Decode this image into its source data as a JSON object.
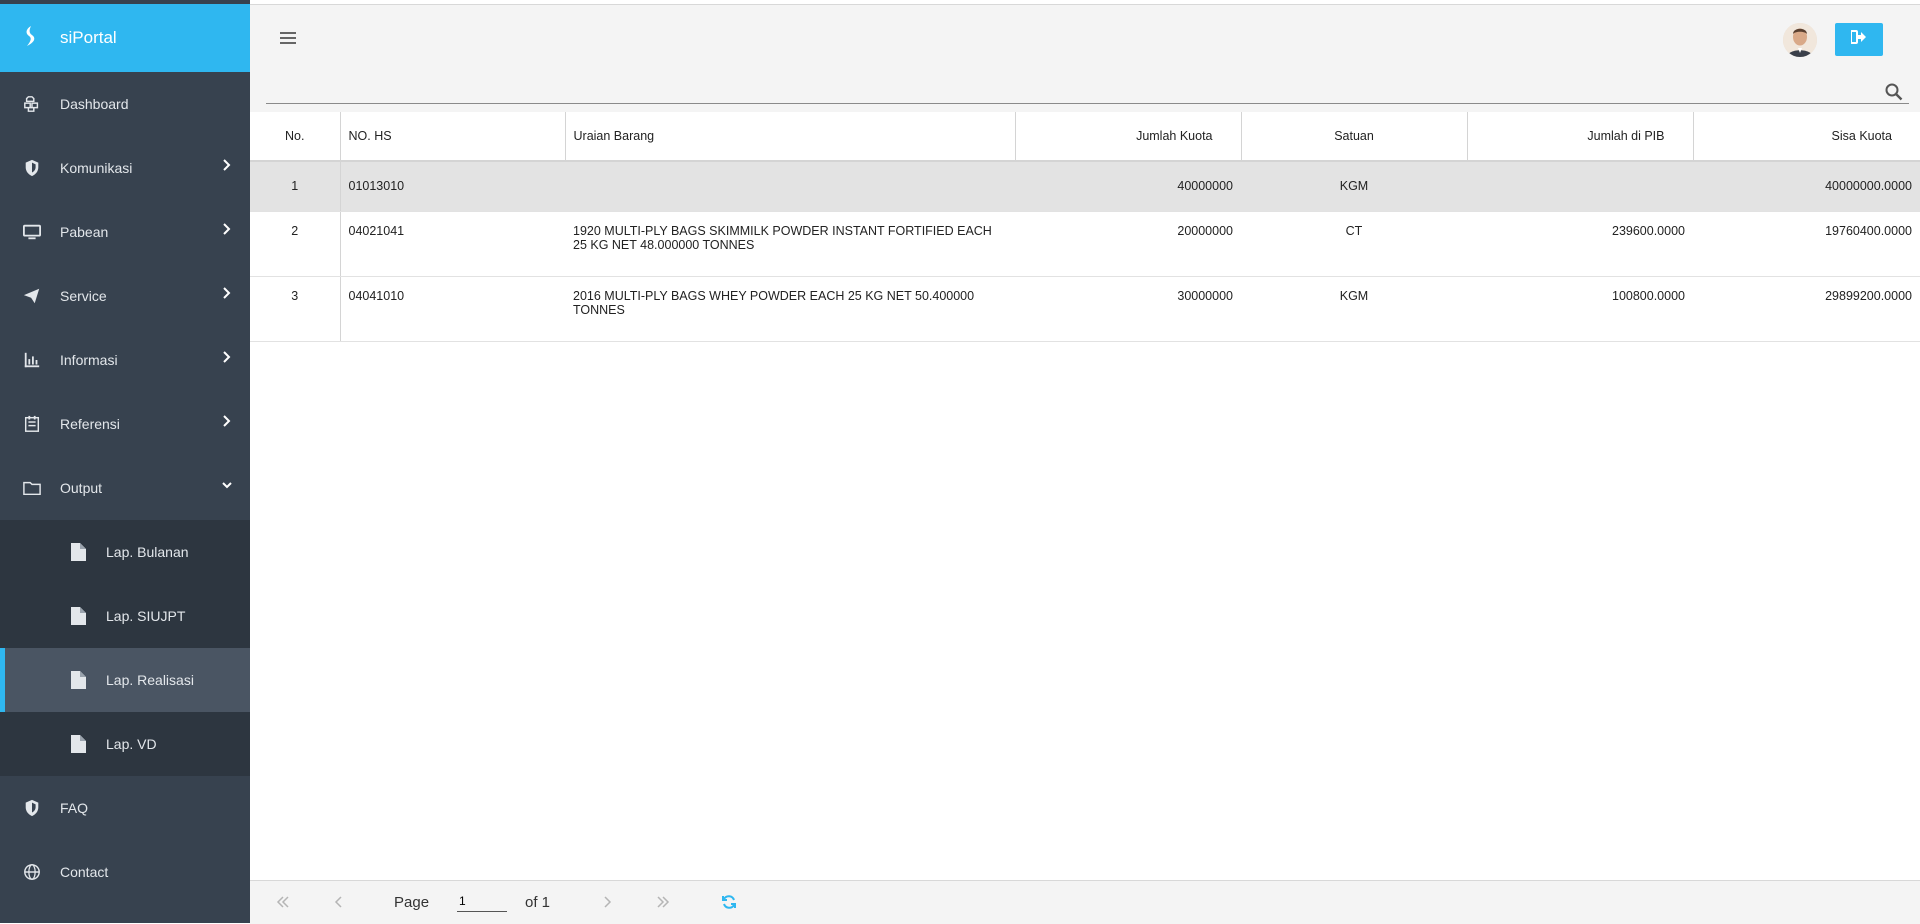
{
  "app": {
    "brand": "siPortal"
  },
  "sidebar": {
    "items": [
      {
        "label": "Dashboard",
        "icon": "cubes-icon",
        "has_children": false
      },
      {
        "label": "Komunikasi",
        "icon": "shield-icon",
        "has_children": true
      },
      {
        "label": "Pabean",
        "icon": "monitor-icon",
        "has_children": true
      },
      {
        "label": "Service",
        "icon": "paper-plane-icon",
        "has_children": true
      },
      {
        "label": "Informasi",
        "icon": "bar-chart-icon",
        "has_children": true
      },
      {
        "label": "Referensi",
        "icon": "calendar-icon",
        "has_children": true
      },
      {
        "label": "Output",
        "icon": "folder-icon",
        "has_children": true,
        "expanded": true
      }
    ],
    "output_children": [
      {
        "label": "Lap. Bulanan",
        "icon": "file-icon"
      },
      {
        "label": "Lap. SIUJPT",
        "icon": "file-icon"
      },
      {
        "label": "Lap. Realisasi",
        "icon": "file-icon",
        "active": true
      },
      {
        "label": "Lap. VD",
        "icon": "file-icon"
      }
    ],
    "bottom_items": [
      {
        "label": "FAQ",
        "icon": "shield-icon"
      },
      {
        "label": "Contact",
        "icon": "globe-icon"
      }
    ]
  },
  "table": {
    "columns": [
      "No.",
      "NO. HS",
      "Uraian Barang",
      "Jumlah Kuota",
      "Satuan",
      "Jumlah di PIB",
      "Sisa Kuota"
    ],
    "rows": [
      {
        "no": "1",
        "hs": "01013010",
        "uraian": "",
        "kuota": "40000000",
        "satuan": "KGM",
        "pib": "",
        "sisa": "40000000.0000"
      },
      {
        "no": "2",
        "hs": "04021041",
        "uraian": "1920 MULTI-PLY BAGS SKIMMILK POWDER INSTANT FORTIFIED EACH 25 KG NET 48.000000 TONNES",
        "kuota": "20000000",
        "satuan": "CT",
        "pib": "239600.0000",
        "sisa": "19760400.0000"
      },
      {
        "no": "3",
        "hs": "04041010",
        "uraian": "2016 MULTI-PLY BAGS WHEY POWDER EACH 25 KG NET 50.400000 TONNES",
        "kuota": "30000000",
        "satuan": "KGM",
        "pib": "100800.0000",
        "sisa": "29899200.0000"
      }
    ]
  },
  "pager": {
    "page_label": "Page",
    "page_value": "1",
    "of_label": "of 1"
  },
  "colors": {
    "accent": "#2fb7f0",
    "sidebar_bg": "#37424f",
    "submenu_bg": "#2d3640",
    "active_item_bg": "#4a5563"
  }
}
